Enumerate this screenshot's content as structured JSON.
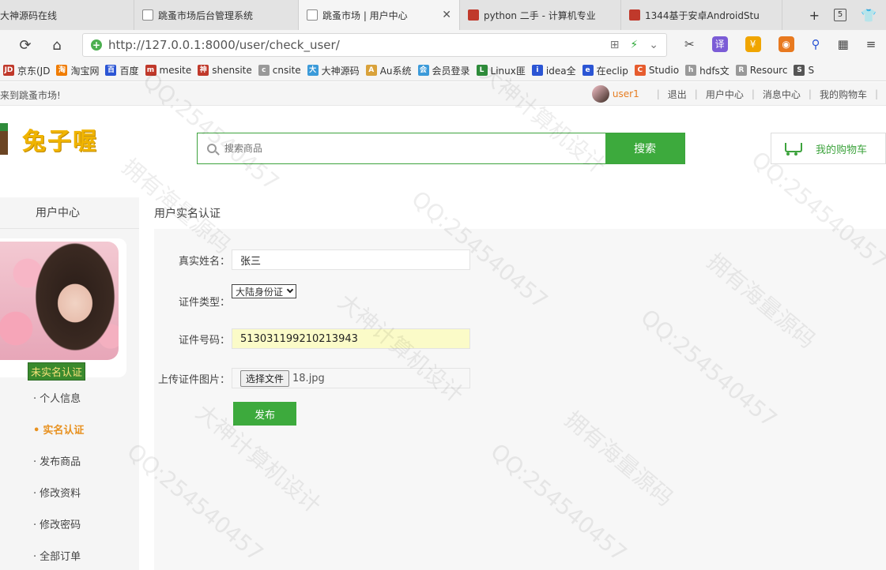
{
  "browser": {
    "tabs": [
      {
        "label": "大神源码在线",
        "icon": "page"
      },
      {
        "label": "跳蚤市场后台管理系统",
        "icon": "page"
      },
      {
        "label": "跳蚤市场 | 用户中心",
        "icon": "page",
        "active": true
      },
      {
        "label": "python 二手 - 计算机专业",
        "icon": "red"
      },
      {
        "label": "1344基于安卓AndroidStu",
        "icon": "red"
      }
    ],
    "tab_count": "5",
    "url": "http://127.0.0.1:8000/user/check_user/",
    "bookmarks": [
      {
        "label": "京东(JD",
        "icon": "JD",
        "color": "#c0392b"
      },
      {
        "label": "淘宝网",
        "icon": "淘",
        "color": "#f07c00"
      },
      {
        "label": "百度",
        "icon": "百",
        "color": "#2b55d4"
      },
      {
        "label": "mesite",
        "icon": "m",
        "color": "#c0392b"
      },
      {
        "label": "shensite",
        "icon": "神",
        "color": "#c0392b"
      },
      {
        "label": "cnsite",
        "icon": "c",
        "color": "#999999"
      },
      {
        "label": "大神源码",
        "icon": "大",
        "color": "#3b9ad9"
      },
      {
        "label": "Au系统",
        "icon": "A",
        "color": "#d9a23b"
      },
      {
        "label": "会员登录",
        "icon": "会",
        "color": "#3b9ad9"
      },
      {
        "label": "Linux匪",
        "icon": "L",
        "color": "#2e8b3a"
      },
      {
        "label": "idea全",
        "icon": "i",
        "color": "#2b55d4"
      },
      {
        "label": "在eclip",
        "icon": "e",
        "color": "#2b55d4"
      },
      {
        "label": "Studio",
        "icon": "C",
        "color": "#e65c2e"
      },
      {
        "label": "hdfs文",
        "icon": "h",
        "color": "#999999"
      },
      {
        "label": "Resourc",
        "icon": "R",
        "color": "#999999"
      },
      {
        "label": "S",
        "icon": "S",
        "color": "#555555"
      }
    ]
  },
  "site": {
    "welcome": "来到跳蚤市场!",
    "username": "user1",
    "topnav": [
      "退出",
      "用户中心",
      "消息中心",
      "我的购物车"
    ],
    "logo_text": "兔子喔",
    "search_placeholder": "搜索商品",
    "search_button": "搜索",
    "cart_label": "我的购物车"
  },
  "sidebar": {
    "title": "用户中心",
    "auth_status": "未实名认证",
    "menu": [
      {
        "label": "个人信息",
        "active": false
      },
      {
        "label": "实名认证",
        "active": true
      },
      {
        "label": "发布商品",
        "active": false
      },
      {
        "label": "修改资料",
        "active": false
      },
      {
        "label": "修改密码",
        "active": false
      },
      {
        "label": "全部订单",
        "active": false
      }
    ]
  },
  "form": {
    "title": "用户实名认证",
    "name_label": "真实姓名：",
    "name_value": "张三",
    "id_type_label": "证件类型：",
    "id_type_value": "大陆身份证",
    "id_number_label": "证件号码：",
    "id_number_value": "513031199210213943",
    "upload_label": "上传证件图片：",
    "file_button": "选择文件",
    "file_name": "18.jpg",
    "submit_label": "发布"
  },
  "watermarks": [
    "拥有海量源码",
    "QQ:254540457",
    "大神计算机设计"
  ]
}
